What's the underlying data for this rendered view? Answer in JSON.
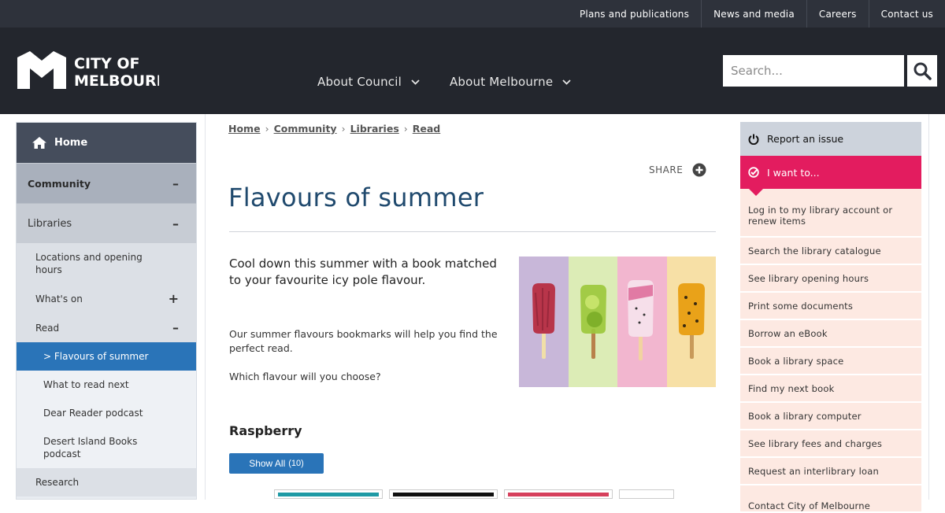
{
  "utility_nav": [
    "Plans and publications",
    "News and media",
    "Careers",
    "Contact us"
  ],
  "logo": {
    "line1": "CITY OF",
    "line2": "MELBOURNE"
  },
  "main_nav": [
    "About Council",
    "About Melbourne"
  ],
  "search": {
    "placeholder": "Search..."
  },
  "sidebar": {
    "home": "Home",
    "community": "Community",
    "libraries": "Libraries",
    "items": [
      {
        "label": "Locations and opening hours",
        "level": 2,
        "sign": ""
      },
      {
        "label": "What's on",
        "level": 2,
        "sign": "+"
      },
      {
        "label": "Read",
        "level": 2,
        "sign": "–"
      },
      {
        "label": "> Flavours of summer",
        "level": 3,
        "sign": "",
        "active": true
      },
      {
        "label": "What to read next",
        "level": 3,
        "sign": ""
      },
      {
        "label": "Dear Reader podcast",
        "level": 3,
        "sign": ""
      },
      {
        "label": "Desert Island Books podcast",
        "level": 3,
        "sign": ""
      },
      {
        "label": "Research",
        "level": 2,
        "sign": ""
      }
    ]
  },
  "breadcrumb": [
    "Home",
    "Community",
    "Libraries",
    "Read"
  ],
  "share_label": "SHARE",
  "page_title": "Flavours of summer",
  "intro": "Cool down this summer with a book matched to your favourite icy pole flavour.",
  "body": [
    "Our summer flavours bookmarks will help you find the perfect read.",
    "Which flavour will you choose?"
  ],
  "section_heading": "Raspberry",
  "show_all": {
    "label": "Show All",
    "count": "(10)"
  },
  "right": {
    "report": "Report an issue",
    "i_want": "I want to...",
    "links": [
      "Log in to my library account or renew items",
      "Search the library catalogue",
      "See library opening hours",
      "Print some documents",
      "Borrow an eBook",
      "Book a library space",
      "Find my next book",
      "Book a library computer",
      "See library fees and charges",
      "Request an interlibrary loan",
      "Contact City of Melbourne"
    ]
  },
  "colors": {
    "header_bg": "#23262d",
    "utility_bg": "#2e323b",
    "title_blue": "#204a6e",
    "accent_blue": "#2a74b8",
    "accent_pink": "#e31c5f",
    "link_bg": "#fde9e2",
    "hero_panels": [
      "#c8b7d9",
      "#dcecb6",
      "#f2b6cf",
      "#f7e0a6"
    ],
    "icy_poles": [
      "#b8354a",
      "#9bc83a",
      "#f0c2d6",
      "#e9a219"
    ]
  }
}
